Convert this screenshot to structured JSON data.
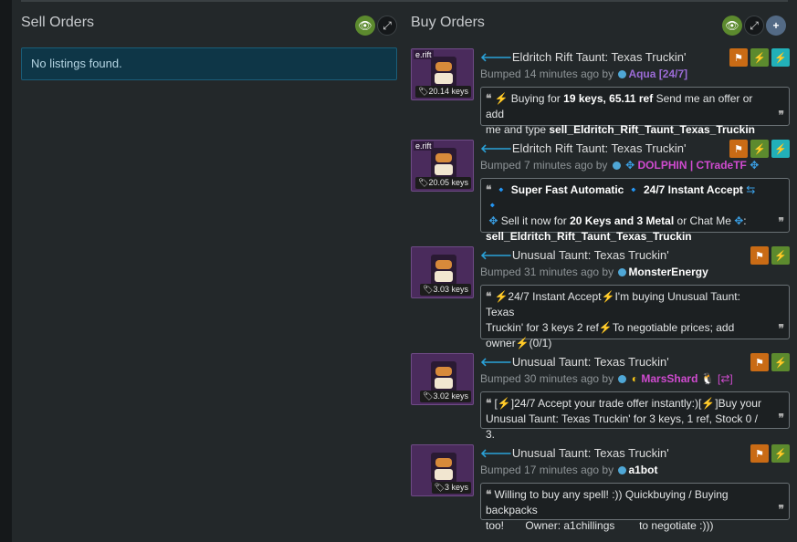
{
  "sell": {
    "title": "Sell Orders",
    "empty": "No listings found."
  },
  "buy": {
    "title": "Buy Orders"
  },
  "header_icons": {
    "sell": [
      "eye-slash-icon",
      "expand-icon"
    ],
    "buy": [
      "eye-slash-icon",
      "expand-icon",
      "plus-icon"
    ]
  },
  "listings": [
    {
      "tag": "e.rift",
      "price": "20.14 keys",
      "title": "Eldritch Rift Taunt: Texas Truckin'",
      "bumped": "Bumped 14 minutes ago by",
      "user": "Aqua [24/7]",
      "user_color": "#9b6bd6",
      "l1a": "Buying for ",
      "l1b": "19 keys, 65.11 ref",
      "l1c": " Send me an offer or add",
      "l2a": "me and type ",
      "l2b": "sell_Eldritch_Rift_Taunt_Texas_Truckin"
    },
    {
      "tag": "e.rift",
      "price": "20.05 keys",
      "title": "Eldritch Rift Taunt: Texas Truckin'",
      "bumped": "Bumped 7 minutes ago by",
      "user": "DOLPHIN | CTradeTF",
      "user_color": "#d04bd0",
      "l1a": "Super Fast Automatic",
      "l1b": "24/7 Instant Accept",
      "l2a": "Sell it now for ",
      "l2b": "20 Keys and 3 Metal",
      "l2c": " or Chat Me",
      "l3": "sell_Eldritch_Rift_Taunt_Texas_Truckin"
    },
    {
      "price": "3.03 keys",
      "title": "Unusual Taunt: Texas Truckin'",
      "bumped": "Bumped 31 minutes ago by",
      "user": "MonsterEnergy",
      "user_color": "#ffffff",
      "l1a": "24/7 Instant Accept",
      "l1b": "I'm buying Unusual Taunt: Texas",
      "l2a": "Truckin' for 3 keys 2 ref",
      "l2b": "To negotiable prices; add",
      "l3a": "owner",
      "l3b": "(0/1)"
    },
    {
      "price": "3.02 keys",
      "title": "Unusual Taunt: Texas Truckin'",
      "bumped": "Bumped 30 minutes ago by",
      "user": "MarsShard",
      "user_suffix": "[⇄]",
      "user_color": "#d04bd0",
      "l1a": "[",
      "l1b": "]24/7 Accept your trade offer instantly:)[",
      "l1c": "]Buy your",
      "l2": "Unusual Taunt: Texas Truckin' for 3 keys, 1 ref, Stock 0 / 3."
    },
    {
      "price": "3 keys",
      "title": "Unusual Taunt: Texas Truckin'",
      "bumped": "Bumped 17 minutes ago by",
      "user": "a1bot",
      "user_color": "#ffffff",
      "l1": "Willing to buy any spell! :)) Quickbuying / Buying backpacks",
      "l2a": "too!",
      "l2b": "Owner: a1chillings",
      "l2c": "to negotiate :)))"
    }
  ]
}
